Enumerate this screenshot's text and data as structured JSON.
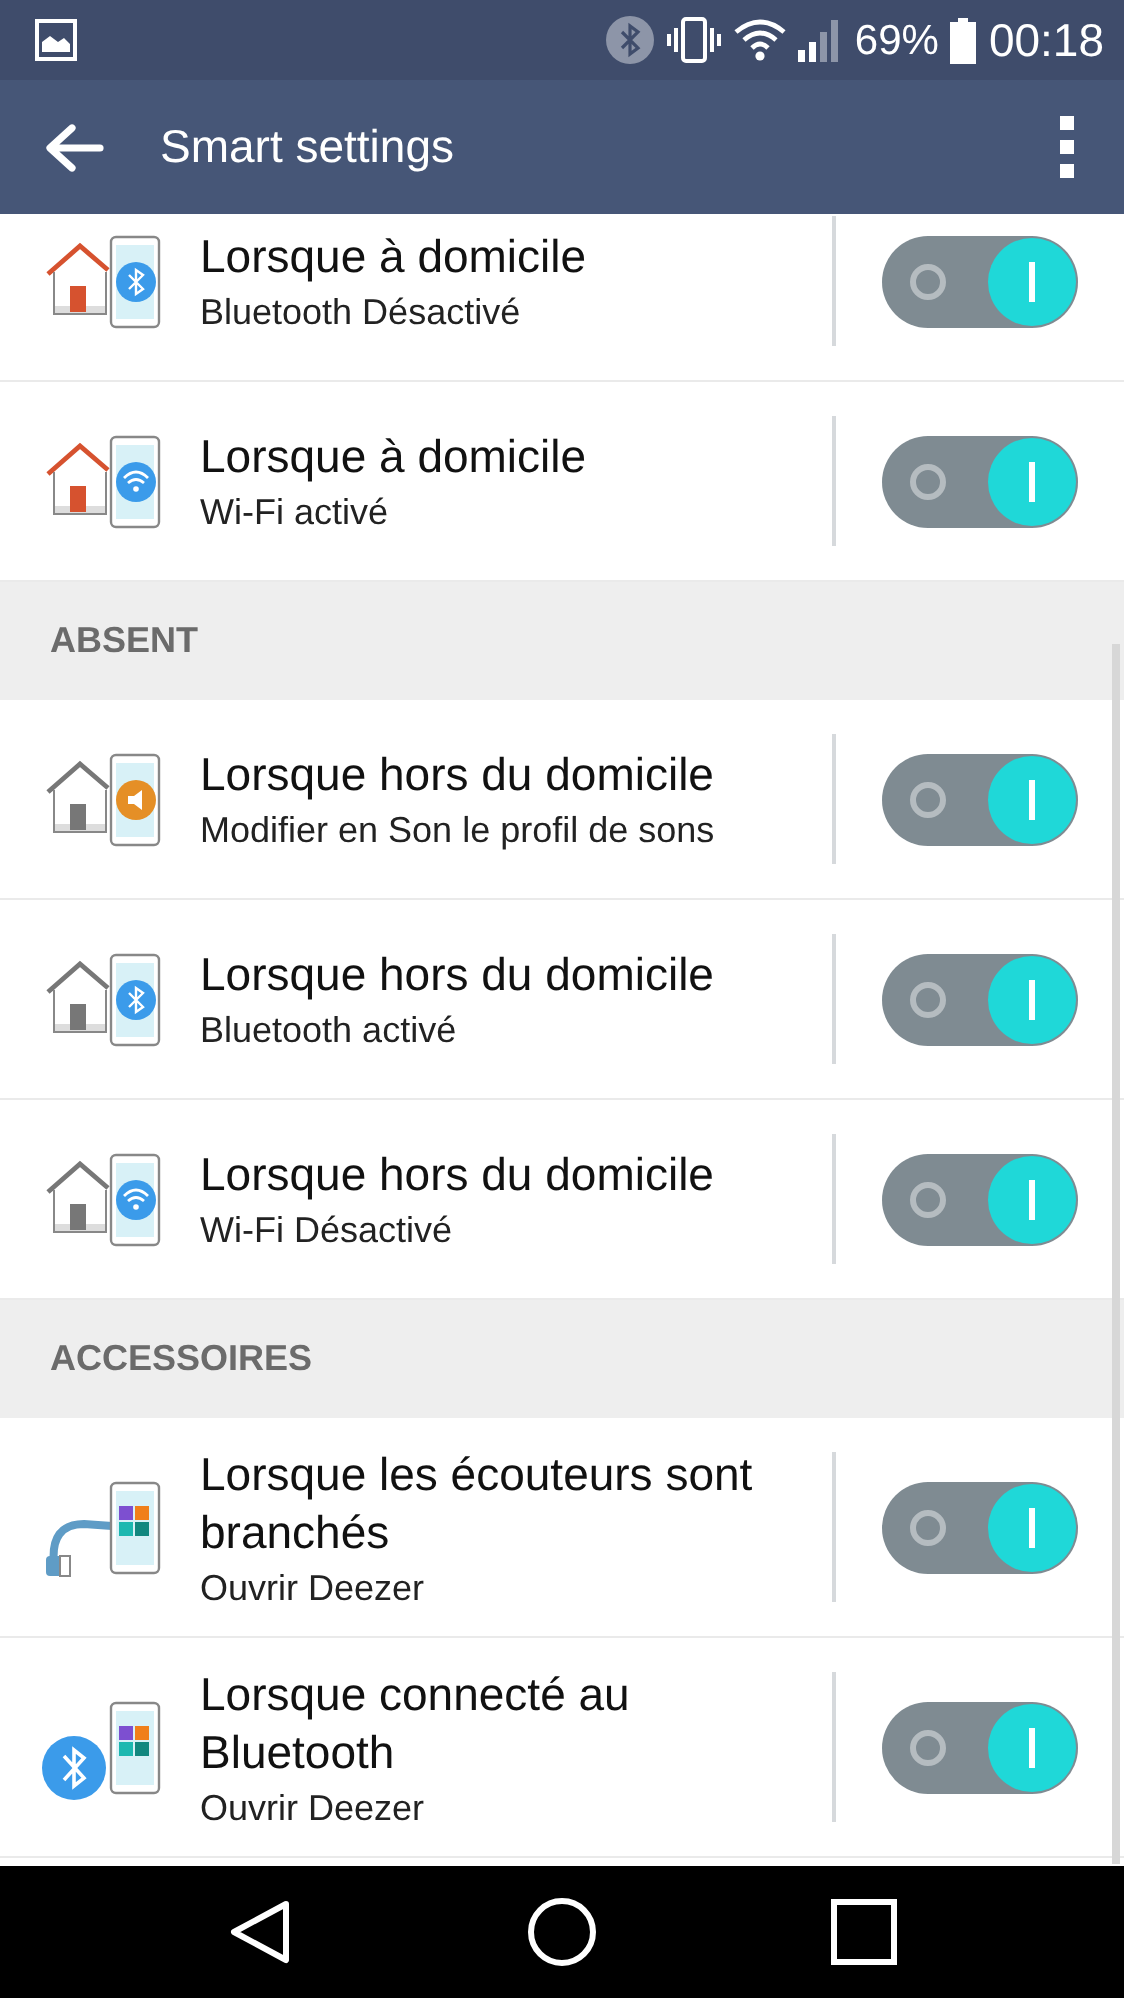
{
  "status_bar": {
    "battery_text": "69%",
    "time": "00:18"
  },
  "app_bar": {
    "title": "Smart settings"
  },
  "sections": [
    {
      "rows": [
        {
          "title": "Lorsque à domicile",
          "subtitle": "Bluetooth Désactivé",
          "kind": "homebluetooth",
          "on": true
        },
        {
          "title": "Lorsque à domicile",
          "subtitle": "Wi-Fi activé",
          "kind": "homewifi",
          "on": true
        }
      ]
    },
    {
      "header": "ABSENT",
      "rows": [
        {
          "title": "Lorsque hors du domicile",
          "subtitle": "Modifier en Son le profil de sons",
          "kind": "awaysound",
          "on": true
        },
        {
          "title": "Lorsque hors du domicile",
          "subtitle": "Bluetooth activé",
          "kind": "awaybluetooth",
          "on": true
        },
        {
          "title": "Lorsque hors du domicile",
          "subtitle": "Wi-Fi Désactivé",
          "kind": "awaywifi",
          "on": true
        }
      ]
    },
    {
      "header": "ACCESSOIRES",
      "rows": [
        {
          "title": "Lorsque les écouteurs sont branchés",
          "subtitle": "Ouvrir Deezer",
          "kind": "headphones",
          "on": true
        },
        {
          "title": "Lorsque connecté au Bluetooth",
          "subtitle": "Ouvrir Deezer",
          "kind": "bluetooth",
          "on": true
        }
      ]
    }
  ]
}
